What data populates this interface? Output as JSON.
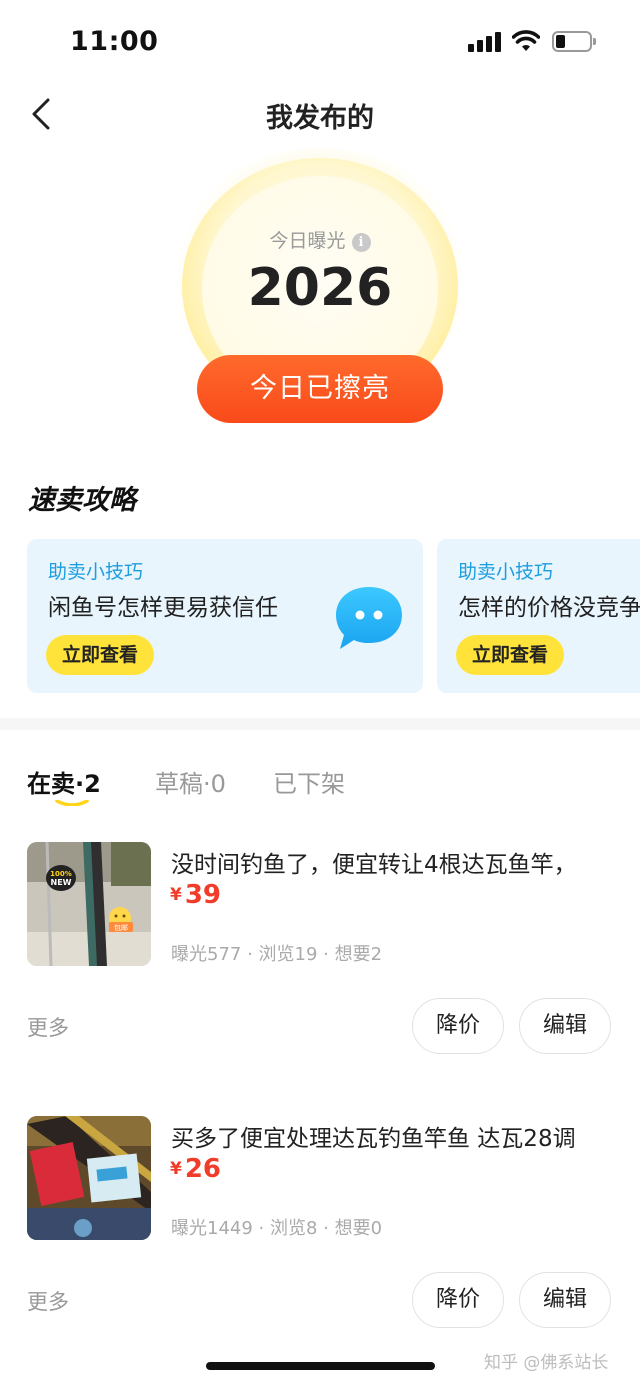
{
  "status_bar": {
    "time": "11:00",
    "battery_level": 0.2
  },
  "header": {
    "title": "我发布的"
  },
  "exposure": {
    "label": "今日曝光",
    "count": "2026",
    "button": "今日已擦亮"
  },
  "strategy": {
    "title": "速卖攻略",
    "cards": [
      {
        "tag": "助卖小技巧",
        "title": "闲鱼号怎样更易获信任",
        "button": "立即查看",
        "icon": "chat-bubble-icon"
      },
      {
        "tag": "助卖小技巧",
        "title": "怎样的价格没竞争",
        "button": "立即查看"
      }
    ]
  },
  "tabs": [
    {
      "label": "在卖·2",
      "active": true
    },
    {
      "label": "草稿·0",
      "active": false
    },
    {
      "label": "已下架",
      "active": false
    }
  ],
  "products": [
    {
      "title": "没时间钓鱼了，便宜转让4根达瓦鱼竿，",
      "currency": "¥",
      "price": "39",
      "stats": "曝光577 · 浏览19 · 想要2",
      "more": "更多",
      "btn_price": "降价",
      "btn_edit": "编辑",
      "thumb_badge": "100% NEW",
      "thumb_sticker": "包邮"
    },
    {
      "title": "买多了便宜处理达瓦钓鱼竿鱼 达瓦28调",
      "currency": "¥",
      "price": "26",
      "stats": "曝光1449 · 浏览8 · 想要0",
      "more": "更多",
      "btn_price": "降价",
      "btn_edit": "编辑"
    }
  ],
  "watermark": "知乎 @佛系站长",
  "colors": {
    "accent_orange": "#f94a1a",
    "price_red": "#f23c2a",
    "tip_blue": "#1e9ddf",
    "tip_yellow": "#ffe33b"
  }
}
